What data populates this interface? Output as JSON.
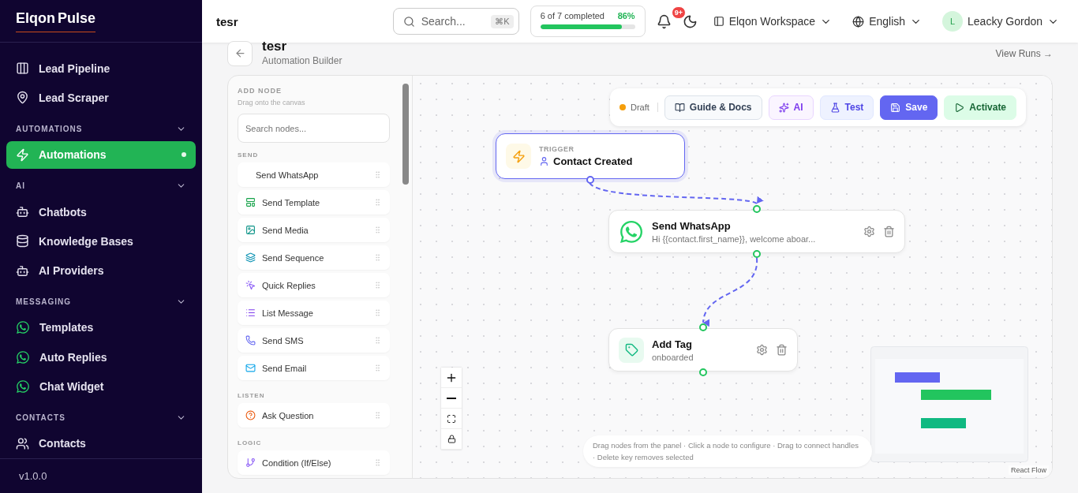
{
  "sidebar": {
    "logo": {
      "first": "Elqon",
      "second": "Pulse"
    },
    "groups": [
      {
        "items": [
          {
            "label": "Lead Pipeline",
            "selected": false
          },
          {
            "label": "Lead Scraper",
            "selected": false
          }
        ]
      },
      {
        "title": "AUTOMATIONS",
        "expanded": true,
        "items": [
          {
            "label": "Automations",
            "selected": true
          }
        ]
      },
      {
        "title": "AI",
        "expanded": true,
        "items": [
          {
            "label": "Chatbots",
            "selected": false
          },
          {
            "label": "Knowledge Bases",
            "selected": false
          },
          {
            "label": "AI Providers",
            "selected": false
          }
        ]
      },
      {
        "title": "MESSAGING",
        "expanded": true,
        "items": [
          {
            "label": "Templates",
            "selected": false
          },
          {
            "label": "Auto Replies",
            "selected": false
          },
          {
            "label": "Chat Widget",
            "selected": false
          }
        ]
      },
      {
        "title": "CONTACTS",
        "expanded": true,
        "items": [
          {
            "label": "Contacts",
            "selected": false
          }
        ]
      }
    ],
    "version": "v1.0.0"
  },
  "topbar": {
    "title": "tesr",
    "search": {
      "placeholder": "Search...",
      "shortcut": "⌘K"
    },
    "progress": {
      "label": "6 of 7 completed",
      "percent": "86%",
      "level": 0.86
    },
    "notifications": "9+",
    "workspace": "Elqon Workspace",
    "language": "English",
    "user": {
      "initial": "L",
      "name": "Leacky Gordon"
    }
  },
  "page": {
    "title": "tesr",
    "subtitle": "Automation Builder",
    "link": "View Runs →"
  },
  "panel": {
    "title": "ADD NODE",
    "hint": "Drag onto the canvas",
    "search": {
      "placeholder": "Search nodes..."
    },
    "sections": [
      {
        "title": "SEND",
        "items": [
          {
            "kind": "plain",
            "label": "Send WhatsApp"
          },
          {
            "kind": "template",
            "label": "Send Template"
          },
          {
            "kind": "media",
            "label": "Send Media"
          },
          {
            "kind": "sequence",
            "label": "Send Sequence"
          },
          {
            "kind": "quick",
            "label": "Quick Replies"
          },
          {
            "kind": "list",
            "label": "List Message"
          },
          {
            "kind": "sms",
            "label": "Send SMS"
          },
          {
            "kind": "email",
            "label": "Send Email"
          }
        ]
      },
      {
        "title": "LISTEN",
        "items": [
          {
            "kind": "question",
            "label": "Ask Question"
          }
        ]
      },
      {
        "title": "LOGIC",
        "items": [
          {
            "kind": "condition",
            "label": "Condition (If/Else)"
          }
        ]
      }
    ]
  },
  "toolbar": {
    "status": "Draft",
    "buttons": [
      {
        "kind": "guide",
        "label": "Guide & Docs"
      },
      {
        "kind": "ai",
        "label": "AI"
      },
      {
        "kind": "test",
        "label": "Test"
      },
      {
        "kind": "save",
        "label": "Save"
      },
      {
        "kind": "activate",
        "label": "Activate"
      }
    ]
  },
  "nodes": [
    {
      "kind": "trigger",
      "label": "TRIGGER",
      "title": "Contact Created",
      "selected": true
    },
    {
      "kind": "whatsapp",
      "title": "Send WhatsApp",
      "subtitle": "Hi {{contact.first_name}}, welcome aboar...",
      "selected": false
    },
    {
      "kind": "tag",
      "title": "Add Tag",
      "subtitle": "onboarded",
      "selected": false
    }
  ],
  "hint": "Drag nodes from the panel · Click a node to configure · Drag to connect handles · Delete key removes selected",
  "attribution": "React Flow"
}
